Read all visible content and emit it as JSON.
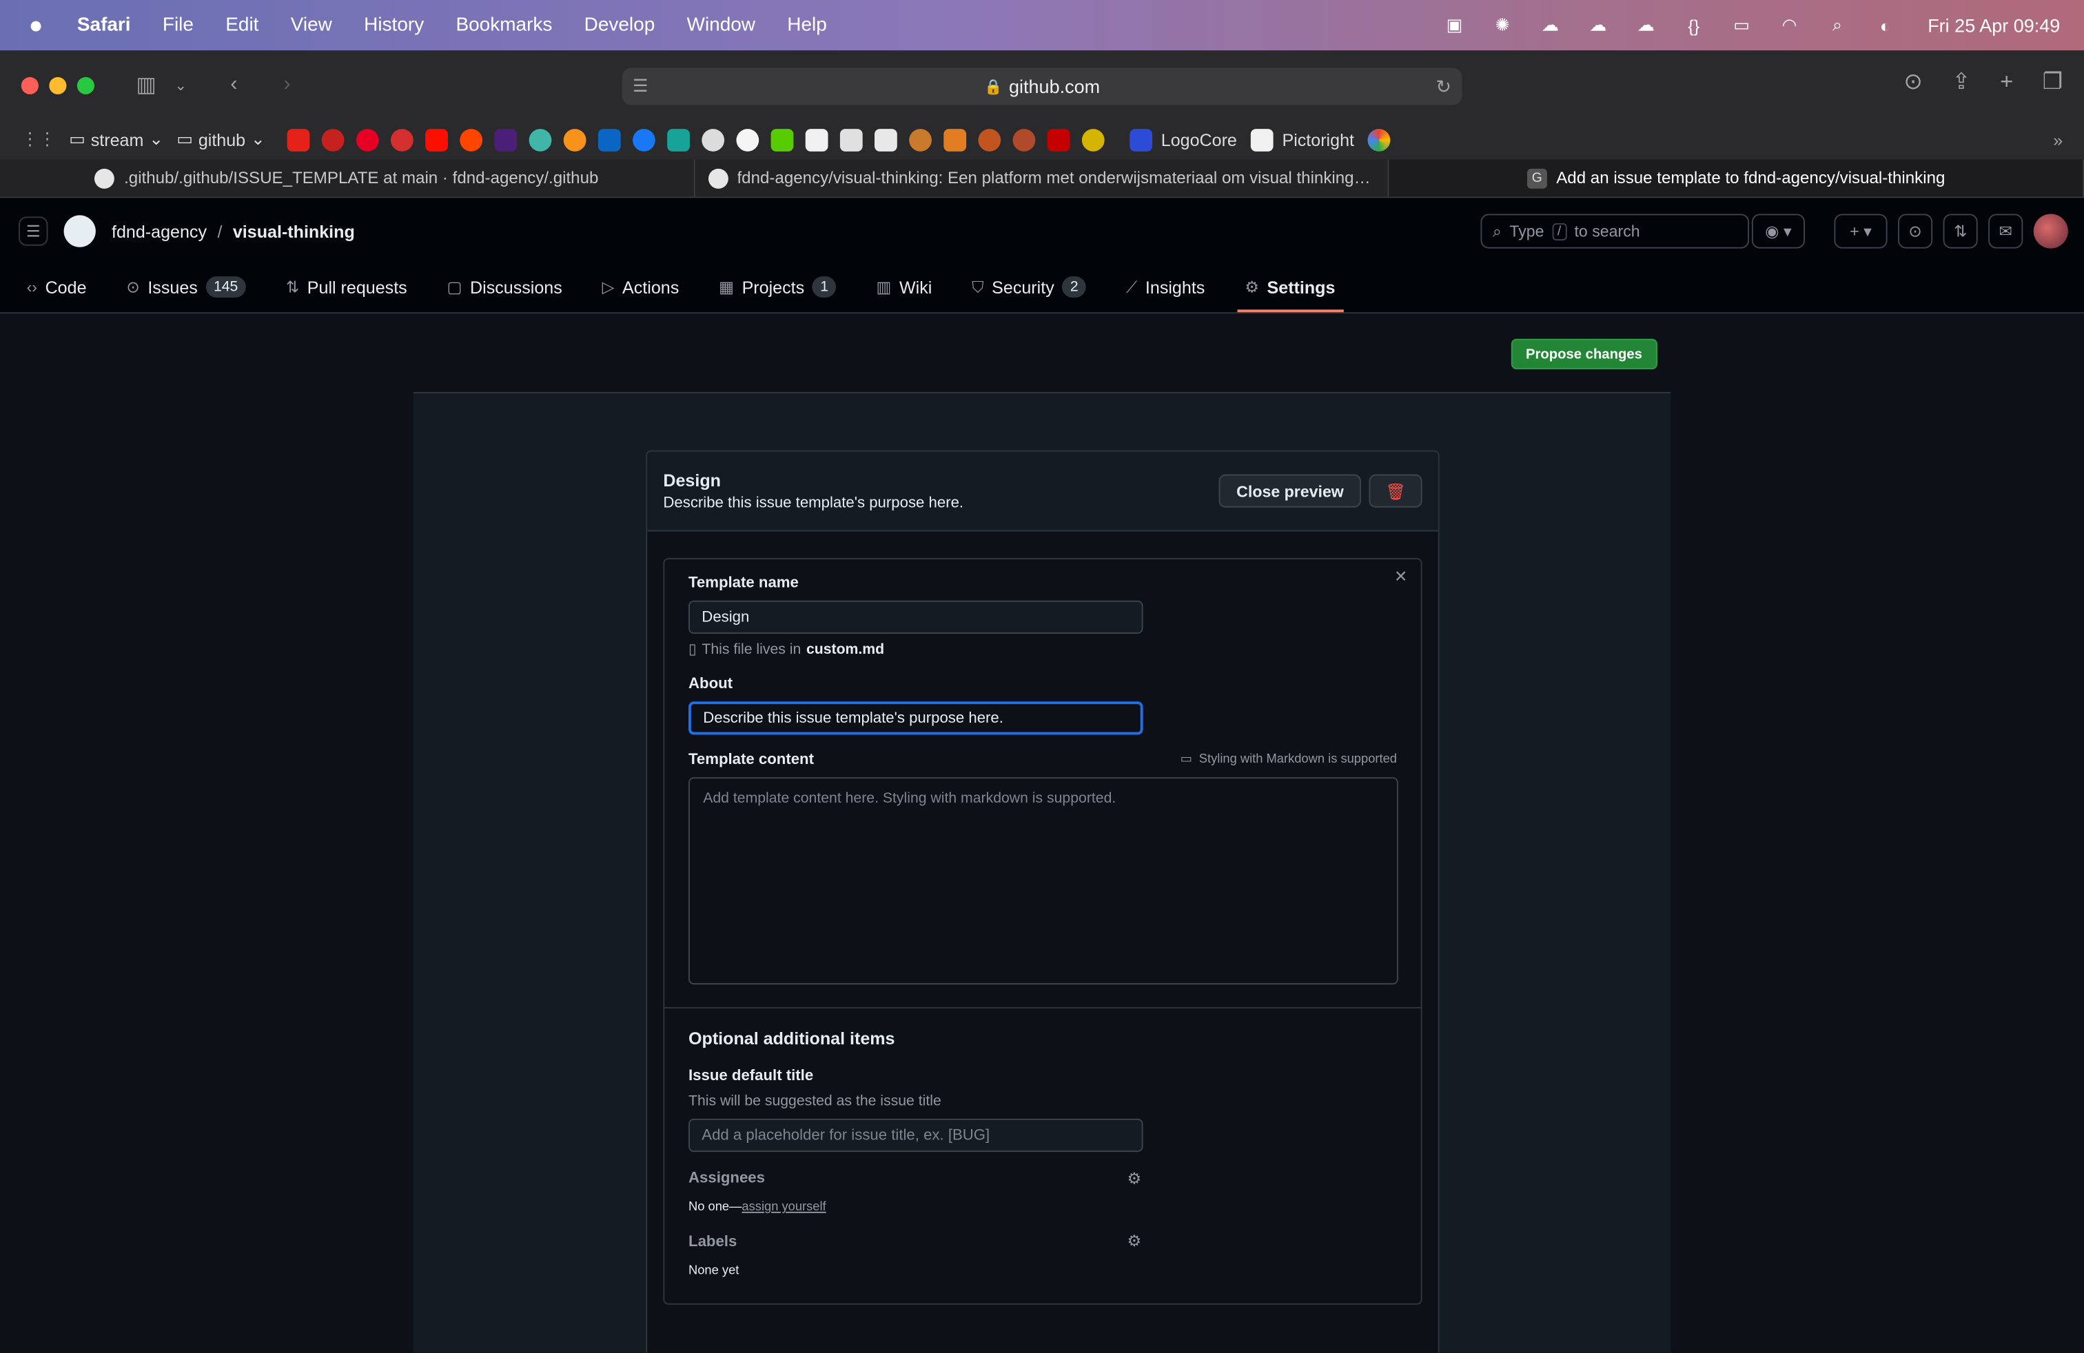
{
  "menubar": {
    "app": "Safari",
    "items": [
      "File",
      "Edit",
      "View",
      "History",
      "Bookmarks",
      "Develop",
      "Window",
      "Help"
    ],
    "clock": "Fri 25 Apr  09:49"
  },
  "browser": {
    "url": "github.com",
    "bookmarks": {
      "folder1": "stream",
      "folder2": "github",
      "logocore": "LogoCore",
      "pictoright": "Pictoright"
    },
    "tabs": [
      ".github/.github/ISSUE_TEMPLATE at main · fdnd-agency/.github",
      "fdnd-agency/visual-thinking: Een platform met onderwijsmateriaal om visual thinking ti...",
      "Add an issue template to fdnd-agency/visual-thinking"
    ],
    "active_tab_icon": "G"
  },
  "github": {
    "owner": "fdnd-agency",
    "separator": "/",
    "repo": "visual-thinking",
    "search_prefix": "Type",
    "search_key": "/",
    "search_suffix": "to search",
    "nav": {
      "code": "Code",
      "issues": "Issues",
      "issues_count": "145",
      "pulls": "Pull requests",
      "discussions": "Discussions",
      "actions": "Actions",
      "projects": "Projects",
      "projects_count": "1",
      "wiki": "Wiki",
      "security": "Security",
      "security_count": "2",
      "insights": "Insights",
      "settings": "Settings"
    }
  },
  "page": {
    "propose_button": "Propose changes",
    "card_title": "Design",
    "card_desc": "Describe this issue template's purpose here.",
    "close_preview": "Close preview",
    "form": {
      "template_name_label": "Template name",
      "template_name_value": "Design",
      "file_hint": "This file lives in",
      "file_name": "custom.md",
      "about_label": "About",
      "about_value": "Describe this issue template's purpose here.",
      "content_label": "Template content",
      "markdown_note": "Styling with Markdown is supported",
      "content_placeholder": "Add template content here. Styling with markdown is supported.",
      "optional_heading": "Optional additional items",
      "default_title_label": "Issue default title",
      "default_title_hint": "This will be suggested as the issue title",
      "default_title_placeholder": "Add a placeholder for issue title, ex. [BUG]",
      "assignees_label": "Assignees",
      "assignees_none": "No one—",
      "assign_yourself": "assign yourself",
      "labels_label": "Labels",
      "labels_none": "None yet"
    }
  },
  "colors": {
    "accent_green": "#238636",
    "focus_blue": "#1f6feb",
    "selected_underline": "#f78166",
    "danger": "#f85149"
  }
}
